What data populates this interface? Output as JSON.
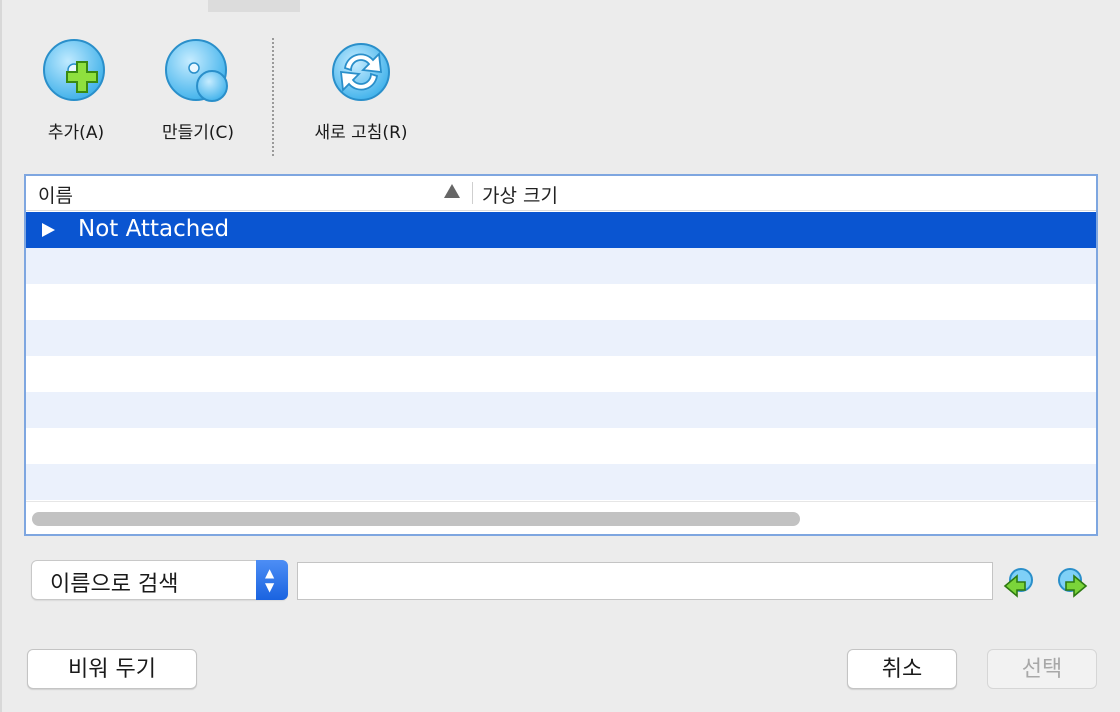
{
  "toolbar": {
    "add_label": "추가(A)",
    "create_label": "만들기(C)",
    "refresh_label": "새로 고침(R)"
  },
  "list": {
    "columns": [
      "이름",
      "가상 크기"
    ],
    "sort_column": "이름",
    "sort_direction": "ascending",
    "rows": [
      {
        "name": "Not Attached",
        "virtual_size": "",
        "selected": true,
        "expandable": true
      }
    ]
  },
  "search": {
    "mode_selected": "이름으로 검색",
    "query": "",
    "find_prev_icon": "find-previous-icon",
    "find_next_icon": "find-next-icon"
  },
  "buttons": {
    "leave_empty": "비워 두기",
    "cancel": "취소",
    "choose": "선택"
  },
  "colors": {
    "selection": "#0a55d1",
    "row_alt": "#ebf1fc",
    "list_border": "#7ea6e0",
    "accent": "#1a63e0"
  },
  "icons": {
    "add": "disk-add-icon",
    "create": "disk-create-icon",
    "refresh": "refresh-icon"
  }
}
